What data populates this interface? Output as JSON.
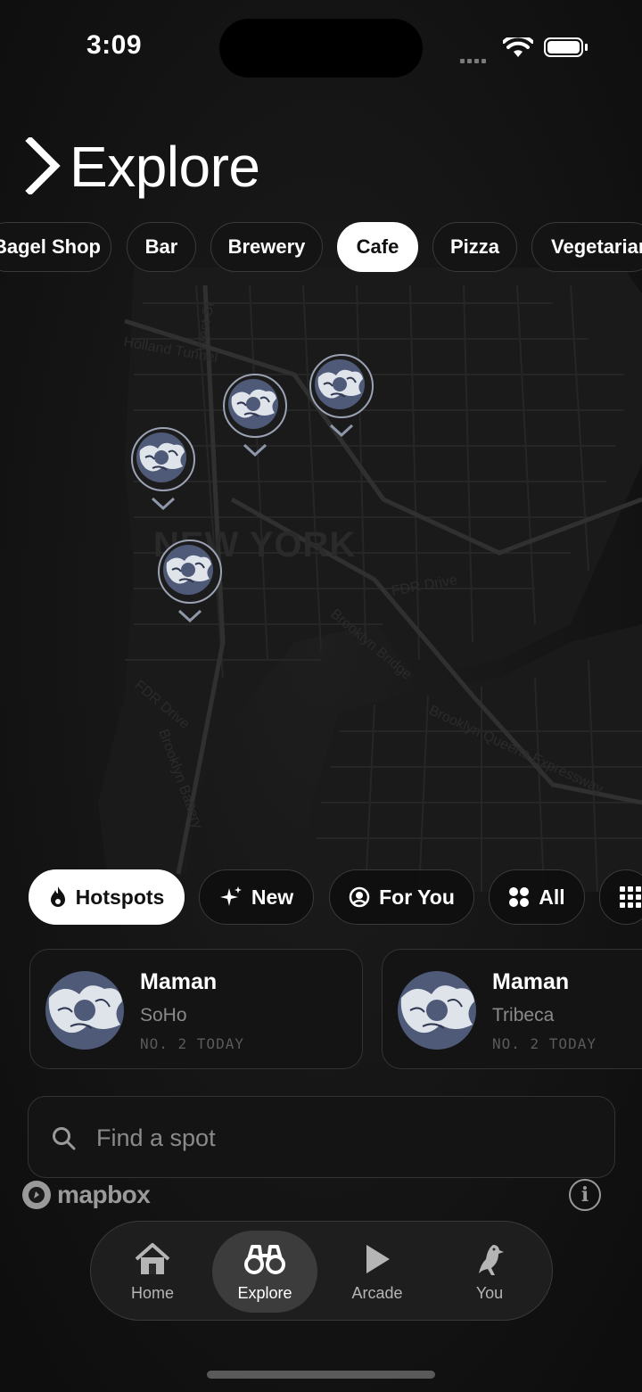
{
  "status_bar": {
    "time": "3:09"
  },
  "header": {
    "title": "Explore"
  },
  "categories": [
    {
      "label": "Bagel Shop",
      "active": false
    },
    {
      "label": "Bar",
      "active": false
    },
    {
      "label": "Brewery",
      "active": false
    },
    {
      "label": "Cafe",
      "active": true
    },
    {
      "label": "Pizza",
      "active": false
    },
    {
      "label": "Vegetarian",
      "active": false
    }
  ],
  "map": {
    "city_label": "NEW YORK",
    "street_labels": [
      "Holland Tunnel",
      "West St",
      "FDR Drive",
      "FDR Drive",
      "Brooklyn Bridge",
      "Brooklyn Queens Expressway",
      "Brooklyn Battery",
      "Drive"
    ]
  },
  "filters": [
    {
      "label": "Hotspots",
      "icon": "flame-icon",
      "active": true
    },
    {
      "label": "New",
      "icon": "sparkle-icon",
      "active": false
    },
    {
      "label": "For You",
      "icon": "user-circle-icon",
      "active": false
    },
    {
      "label": "All",
      "icon": "grid-dots-icon",
      "active": false
    },
    {
      "label": "",
      "icon": "grid-icon",
      "active": false
    }
  ],
  "spots": [
    {
      "name": "Maman",
      "area": "SoHo",
      "rank": "NO. 2 TODAY"
    },
    {
      "name": "Maman",
      "area": "Tribeca",
      "rank": "NO. 2 TODAY"
    }
  ],
  "search": {
    "placeholder": "Find a spot"
  },
  "attribution": {
    "brand": "mapbox",
    "info": "i"
  },
  "tabbar": [
    {
      "label": "Home",
      "icon": "home-icon",
      "active": false
    },
    {
      "label": "Explore",
      "icon": "binoculars-icon",
      "active": true
    },
    {
      "label": "Arcade",
      "icon": "play-icon",
      "active": false
    },
    {
      "label": "You",
      "icon": "bird-icon",
      "active": false
    }
  ],
  "colors": {
    "background": "#151515",
    "active_chip": "#ffffff",
    "pin_ring": "#9aa2b3",
    "pin_fill": "#4e5a78"
  }
}
